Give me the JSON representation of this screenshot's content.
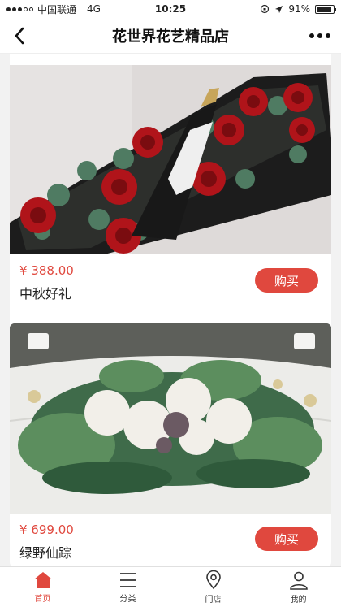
{
  "status_bar": {
    "carrier": "中国联通",
    "network": "4G",
    "time": "10:25",
    "battery": "91%",
    "battery_level": 0.91
  },
  "nav": {
    "title": "花世界花艺精品店",
    "back_icon": "chevron-left-icon",
    "more_icon": "more-dots-icon"
  },
  "products": [
    {
      "price": "¥ 388.00",
      "name": "中秋好礼",
      "buy_label": "购买"
    },
    {
      "price": "¥ 699.00",
      "name": "绿野仙踪",
      "buy_label": "购买"
    }
  ],
  "tabs": [
    {
      "label": "首页",
      "icon": "home-icon",
      "active": true
    },
    {
      "label": "分类",
      "icon": "menu-icon",
      "active": false
    },
    {
      "label": "门店",
      "icon": "location-pin-icon",
      "active": false
    },
    {
      "label": "我的",
      "icon": "user-icon",
      "active": false
    }
  ],
  "colors": {
    "accent": "#e0483e",
    "text": "#222222",
    "background": "#f2f2f2"
  }
}
